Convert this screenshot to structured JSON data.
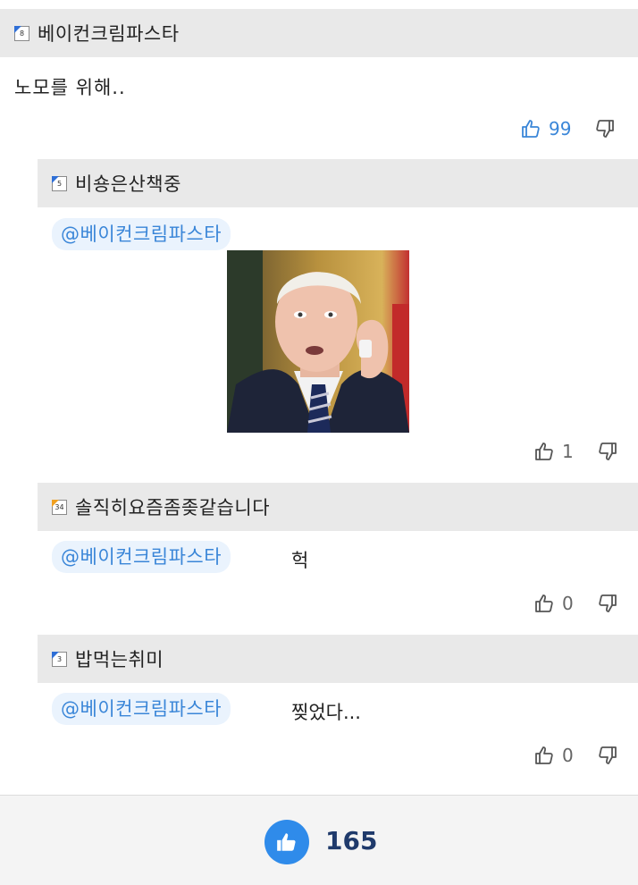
{
  "comments": [
    {
      "username": "베이컨크림파스타",
      "level": "8",
      "level_color": "#2f6fd6",
      "text": "노모를 위해..",
      "likes": "99",
      "like_active": true
    },
    {
      "username": "비숑은산책중",
      "level": "5",
      "level_color": "#2f6fd6",
      "mention": "@베이컨크림파스타",
      "image": "photo of a white-haired man in a suit holding a phone to his ear",
      "likes": "1"
    },
    {
      "username": "솔직히요즘좀좆같습니다",
      "level": "34",
      "level_color": "#f0a020",
      "mention": "@베이컨크림파스타",
      "text": "헉",
      "likes": "0"
    },
    {
      "username": "밥먹는취미",
      "level": "3",
      "level_color": "#2f6fd6",
      "mention": "@베이컨크림파스타",
      "text": "찢었다...",
      "likes": "0"
    }
  ],
  "footer": {
    "like_count": "165",
    "like_icon": "thumbs-up-icon"
  },
  "colors": {
    "accent": "#3a86d8",
    "mention_bg": "#eaf3fd",
    "header_bg": "#e9e9e9",
    "footer_button": "#2f8bea"
  }
}
